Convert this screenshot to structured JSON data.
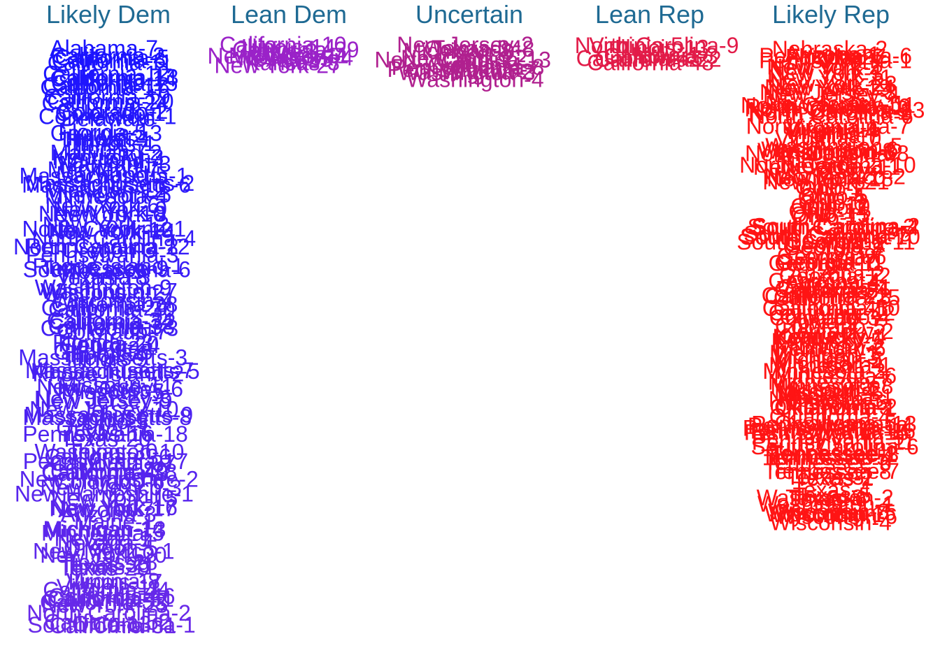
{
  "colors": {
    "header": "#1f6a93",
    "likely_dem": "#1a14ff",
    "likely_dem_end": "#6a2ae8",
    "lean_dem": "#9a22c8",
    "uncertain": "#b0208f",
    "lean_rep": "#e21b48",
    "likely_rep": "#ff1414"
  },
  "chart_data": {
    "type": "text-scatter",
    "categories": [
      "Likely Dem",
      "Lean Dem",
      "Uncertain",
      "Lean Rep",
      "Likely Rep"
    ],
    "series": [
      {
        "category": "Likely Dem",
        "labels": [
          "Alabama-7",
          "California-2",
          "California-5",
          "California-6",
          "California-11",
          "California-12",
          "California-13",
          "California-14",
          "California-15",
          "California-17",
          "California-18",
          "California-19",
          "California-20",
          "California-24",
          "Colorado-1",
          "Colorado-2",
          "Connecticut-1",
          "Delaware",
          "Florida-5",
          "Georgia-13",
          "Hawaii-1",
          "Illinois-1",
          "Illinois-2",
          "Illinois-7",
          "Kentucky-3",
          "Maryland-2",
          "Maryland-3",
          "Maryland-4",
          "Maryland-5",
          "Maryland-7",
          "Massachusetts-1",
          "Massachusetts-2",
          "Massachusetts-6",
          "Michigan-12",
          "Minnesota-4",
          "New York-5",
          "New York-6",
          "New York-8",
          "New York-9",
          "New York-10",
          "New York-12",
          "New York-13",
          "New York-14",
          "North Carolina-1",
          "North Carolina-4",
          "North Carolina-12",
          "Oregon-3",
          "Pennsylvania-2",
          "Pennsylvania-3",
          "Rhode Island-1",
          "South Carolina-6",
          "Tennessee-9",
          "Texas-9",
          "Texas-18",
          "Virginia-3",
          "Washington-7",
          "Washington-9",
          "Wisconsin-2",
          "Wisconsin-4",
          "California-28",
          "California-29",
          "California-30",
          "California-32",
          "California-33",
          "California-34",
          "Colorado-7",
          "Connecticut-3",
          "Florida-20",
          "Florida-23",
          "Georgia-4",
          "Georgia-5",
          "Illinois-4",
          "Illinois-9",
          "Massachusetts-3",
          "Massachusetts-5",
          "Massachusetts-7",
          "Rhode Island-2",
          "Missouri-1",
          "Missouri-5",
          "New Jersey-1",
          "New Jersey-6",
          "New Jersey-8",
          "New Jersey-9",
          "New Jersey-10",
          "Massachusetts-9",
          "Massachusetts-8",
          "Ohio-3",
          "Ohio-11",
          "Oregon-1",
          "Pennsylvania-18",
          "Texas-16",
          "Texas-20",
          "Texas-30",
          "Washington-10",
          "California-36",
          "California-37",
          "Pennsylvania-17",
          "California-38",
          "California-40",
          "California-43",
          "Colorado-6",
          "New Hampshire-2",
          "New Mexico-3",
          "New York-15",
          "New Hampshire-1",
          "New York-16",
          "New York-17",
          "Arizona-3",
          "Arizona-7",
          "Maine-1",
          "Michigan-13",
          "Michigan-14",
          "Minnesota-5",
          "Nevada-1",
          "Nevada-4",
          "New Mexico-1",
          "New York-20",
          "Oregon-5",
          "Texas-28",
          "Texas-29",
          "Texas-35",
          "Illinois-11",
          "Illinois-17",
          "Virginia-8",
          "Virginia-11",
          "California-44",
          "California-46",
          "California-47",
          "California-51",
          "California-53",
          "New York-25",
          "North Carolina-2",
          "Ohio-13",
          "California-52",
          "South Carolina-1",
          "California-31"
        ]
      },
      {
        "category": "Lean Dem",
        "labels": [
          "California-10",
          "California-39",
          "Illinois-14",
          "Iowa-3",
          "Michigan-11",
          "New Jersey-7",
          "New York-4",
          "Texas-25",
          "Kansas-3",
          "New York-27"
        ]
      },
      {
        "category": "Uncertain",
        "labels": [
          "New Jersey-2",
          "Texas-34",
          "Colorado-8",
          "Michigan-8",
          "New York-22",
          "North Carolina-13",
          "Ohio-9",
          "Oregon-4",
          "Pennsylvania-7",
          "Pennsylvania-8",
          "Virginia-2",
          "Washington-3",
          "Washington-4"
        ]
      },
      {
        "category": "Lean Rep",
        "labels": [
          "North Carolina-9",
          "Virginia-5",
          "Illinois-13",
          "Iowa-1",
          "California-3",
          "California-22",
          "California-45",
          "California-48"
        ]
      },
      {
        "category": "Likely Rep",
        "labels": [
          "Nebraska-2",
          "Pennsylvania-6",
          "Arizona-1",
          "Arizona-6",
          "Florida-27",
          "Pennsylvania-1",
          "New York-1",
          "New York-2",
          "New York-3",
          "New York-11",
          "New York-19",
          "New York-23",
          "New York-24",
          "New Jersey-3",
          "New Jersey-4",
          "New Jersey-5",
          "Pennsylvania-10",
          "North Carolina-11",
          "North Carolina-13",
          "North Carolina-3",
          "North Carolina-5",
          "North Carolina-6",
          "North Carolina-7",
          "Virginia-1",
          "Virginia-4",
          "Virginia-6",
          "Virginia-7",
          "Virginia-10",
          "Washington-5",
          "Washington-6",
          "Washington-8",
          "Wisconsin-1",
          "Wisconsin-3",
          "North Carolina-8",
          "North Carolina-10",
          "Nevada-2",
          "Nevada-3",
          "New Jersey-11",
          "New Mexico-2",
          "Montana-1",
          "New York-18",
          "New York-21",
          "Ohio-1",
          "Ohio-2",
          "Ohio-4",
          "Ohio-5",
          "Ohio-6",
          "Ohio-7",
          "Ohio-10",
          "Ohio-12",
          "Ohio-14",
          "Ohio-15",
          "South Carolina-2",
          "South Carolina-3",
          "South Carolina-4",
          "South Carolina-5",
          "South Carolina-7",
          "South Carolina-11",
          "South Carolina-10",
          "Georgia-1",
          "Georgia-2",
          "Georgia-3",
          "Georgia-6",
          "Georgia-7",
          "Georgia-9",
          "Georgia-10",
          "Georgia-11",
          "Georgia-12",
          "Georgia-14",
          "Arizona-2",
          "Arizona-4",
          "Arizona-8",
          "California-1",
          "California-4",
          "California-21",
          "California-23",
          "California-25",
          "California-41",
          "California-42",
          "California-50",
          "Colorado-3",
          "Colorado-4",
          "Colorado-5",
          "Iowa-2",
          "Iowa-4",
          "Kentucky-1",
          "Kentucky-2",
          "Kentucky-4",
          "Kentucky-5",
          "Kentucky-6",
          "Michigan-1",
          "Michigan-2",
          "Michigan-3",
          "Michigan-4",
          "Michigan-5",
          "Minnesota-1",
          "Minnesota-2",
          "Minnesota-3",
          "Minnesota-6",
          "Minnesota-7",
          "Minnesota-8",
          "Missouri-2",
          "Missouri-3",
          "Missouri-4",
          "Missouri-6",
          "Nebraska-1",
          "Nebraska-3",
          "Oklahoma-1",
          "Oklahoma-2",
          "Oklahoma-3",
          "Oklahoma-4",
          "Oklahoma-5",
          "Pennsylvania-12",
          "Pennsylvania-13",
          "Pennsylvania-14",
          "Pennsylvania-15",
          "Pennsylvania-16",
          "Pennsylvania-11",
          "Pennsylvania-9",
          "South Carolina-6",
          "Tennessee-1",
          "Tennessee-2",
          "Tennessee-3",
          "Tennessee-4",
          "Tennessee-5",
          "Tennessee-6",
          "Tennessee-7",
          "Tennessee-8",
          "Texas-1",
          "Texas-2",
          "Texas-3",
          "Texas-4",
          "Texas-5",
          "Texas-6",
          "Texas-8",
          "Washington-1",
          "Washington-2",
          "Wisconsin-5",
          "Wisconsin-6",
          "Wisconsin-7",
          "Wisconsin-8",
          "Wyoming-1",
          "Wisconsin-4"
        ]
      }
    ]
  }
}
